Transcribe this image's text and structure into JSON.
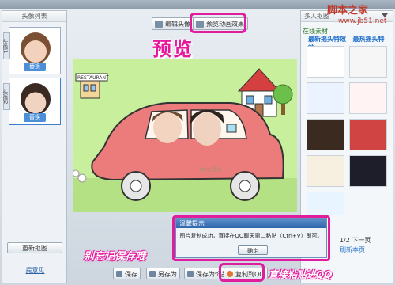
{
  "site": {
    "mark": "脚本之家",
    "url": "www.jb51.net"
  },
  "left_panel": {
    "title": "头像列表",
    "slots": [
      {
        "tab": "头像1",
        "replace": "替换"
      },
      {
        "tab": "头像2",
        "replace": "替换"
      }
    ],
    "repick_button": "重新抠图",
    "link": "提意见"
  },
  "toolbar": {
    "edit_avatar": "编辑头像",
    "preview_animation": "预览动画效果"
  },
  "canvas": {
    "preview_label": "预览",
    "restaurant_sign": "RESTAURANT",
    "watermark": "meitu"
  },
  "right_panel": {
    "header": "多人抠图",
    "online_tab": "在线素材",
    "tabs": [
      "最新摇头特效",
      "最热摇头特效"
    ],
    "pager": "1/2 下一页",
    "refresh": "刷新本页"
  },
  "bottom_toolbar": {
    "save": "保存",
    "save_as": "另存为",
    "save_as_gif": "保存为饰品",
    "copy_to_qq": "复制到QQ"
  },
  "annotations": {
    "dont_forget_save": "别忘记保存哦",
    "paste_to_qq": "直接粘贴进QQ"
  },
  "dialog": {
    "title": "温馨提示",
    "message": "图片复制成功，直接在QQ聊天窗口粘贴（Ctrl+V）即可。",
    "ok": "确定"
  },
  "colors": {
    "highlight": "#e01d9c",
    "accent_blue": "#4c8fd8"
  }
}
